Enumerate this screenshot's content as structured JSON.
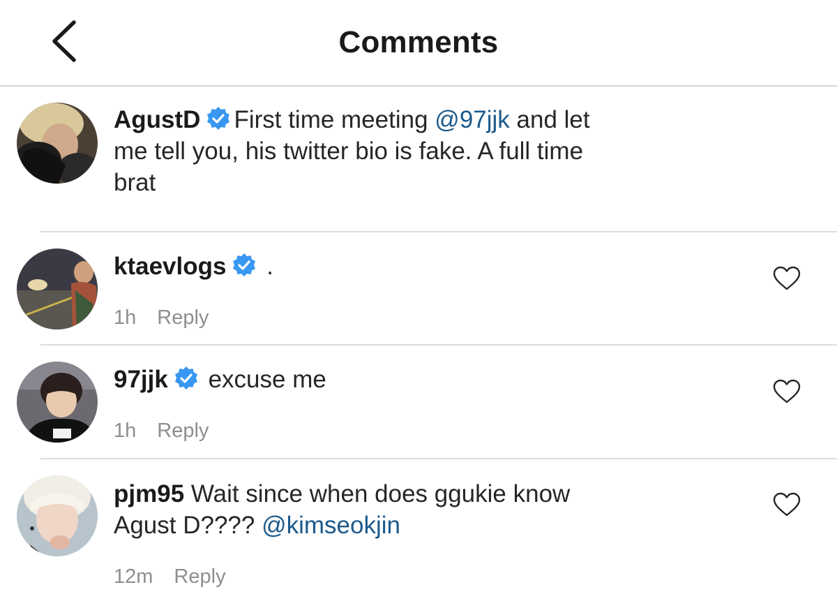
{
  "header": {
    "title": "Comments",
    "back_icon": "chevron-left-icon"
  },
  "caption": {
    "username": "AgustD",
    "verified": true,
    "text_before": "First time meeting ",
    "mention": "@97jjk",
    "text_after": " and let me tell you, his twitter bio is fake. A full time brat"
  },
  "comments": [
    {
      "username": "ktaevlogs",
      "verified": true,
      "text": ".",
      "time": "1h",
      "reply_label": "Reply",
      "like_icon": "heart-outline-icon"
    },
    {
      "username": "97jjk",
      "verified": true,
      "text": "excuse me",
      "time": "1h",
      "reply_label": "Reply",
      "like_icon": "heart-outline-icon"
    },
    {
      "username": "pjm95",
      "verified": false,
      "text_before": " Wait since when does ggukie know Agust D???? ",
      "mention": "@kimseokjin",
      "time": "12m",
      "reply_label": "Reply",
      "like_icon": "heart-outline-icon"
    }
  ],
  "colors": {
    "text": "#262626",
    "meta": "#8e8e8e",
    "mention": "#1c5a8c",
    "verified_badge": "#3897f0",
    "divider": "#dcdcdc"
  }
}
